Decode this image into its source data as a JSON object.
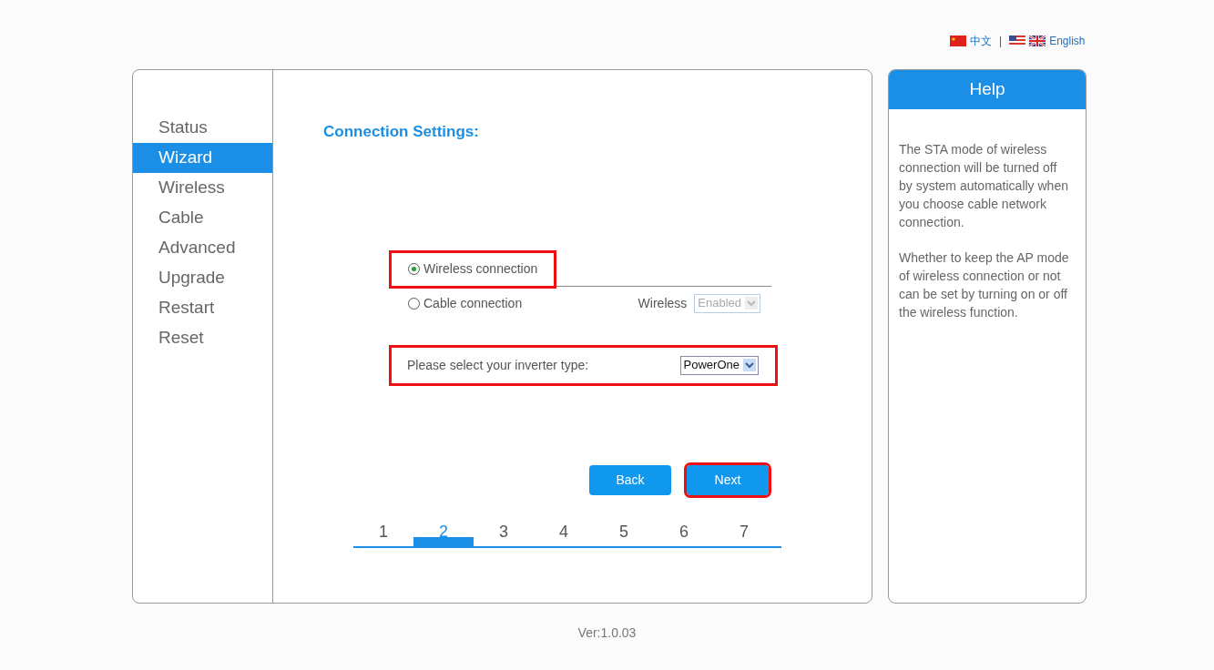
{
  "languages": {
    "chinese": "中文",
    "separator": "|",
    "english": "English"
  },
  "sidebar": {
    "items": [
      {
        "label": "Status",
        "selected": false
      },
      {
        "label": "Wizard",
        "selected": true
      },
      {
        "label": "Wireless",
        "selected": false
      },
      {
        "label": "Cable",
        "selected": false
      },
      {
        "label": "Advanced",
        "selected": false
      },
      {
        "label": "Upgrade",
        "selected": false
      },
      {
        "label": "Restart",
        "selected": false
      },
      {
        "label": "Reset",
        "selected": false
      }
    ]
  },
  "heading": "Connection Settings:",
  "connection_options": [
    {
      "label": "Wireless connection",
      "selected": true,
      "highlighted": true
    },
    {
      "label": "Cable connection",
      "selected": false,
      "highlighted": false
    }
  ],
  "wireless_select": {
    "label": "Wireless",
    "value": "Enabled",
    "disabled": true
  },
  "inverter": {
    "label": "Please select your inverter type:",
    "value": "PowerOne",
    "highlighted": true
  },
  "buttons": [
    {
      "label": "Back",
      "highlighted": false
    },
    {
      "label": "Next",
      "highlighted": true
    }
  ],
  "steps": [
    {
      "label": "1",
      "selected": false
    },
    {
      "label": "2",
      "selected": true
    },
    {
      "label": "3",
      "selected": false
    },
    {
      "label": "4",
      "selected": false
    },
    {
      "label": "5",
      "selected": false
    },
    {
      "label": "6",
      "selected": false
    },
    {
      "label": "7",
      "selected": false
    }
  ],
  "help": {
    "title": "Help",
    "paragraphs": [
      "The STA mode of wireless connection will be turned off by system automatically when you choose cable network connection.",
      "Whether to keep the AP mode of wireless connection or not can be set by turning on or off the wireless function."
    ]
  },
  "version": "Ver:1.0.03"
}
